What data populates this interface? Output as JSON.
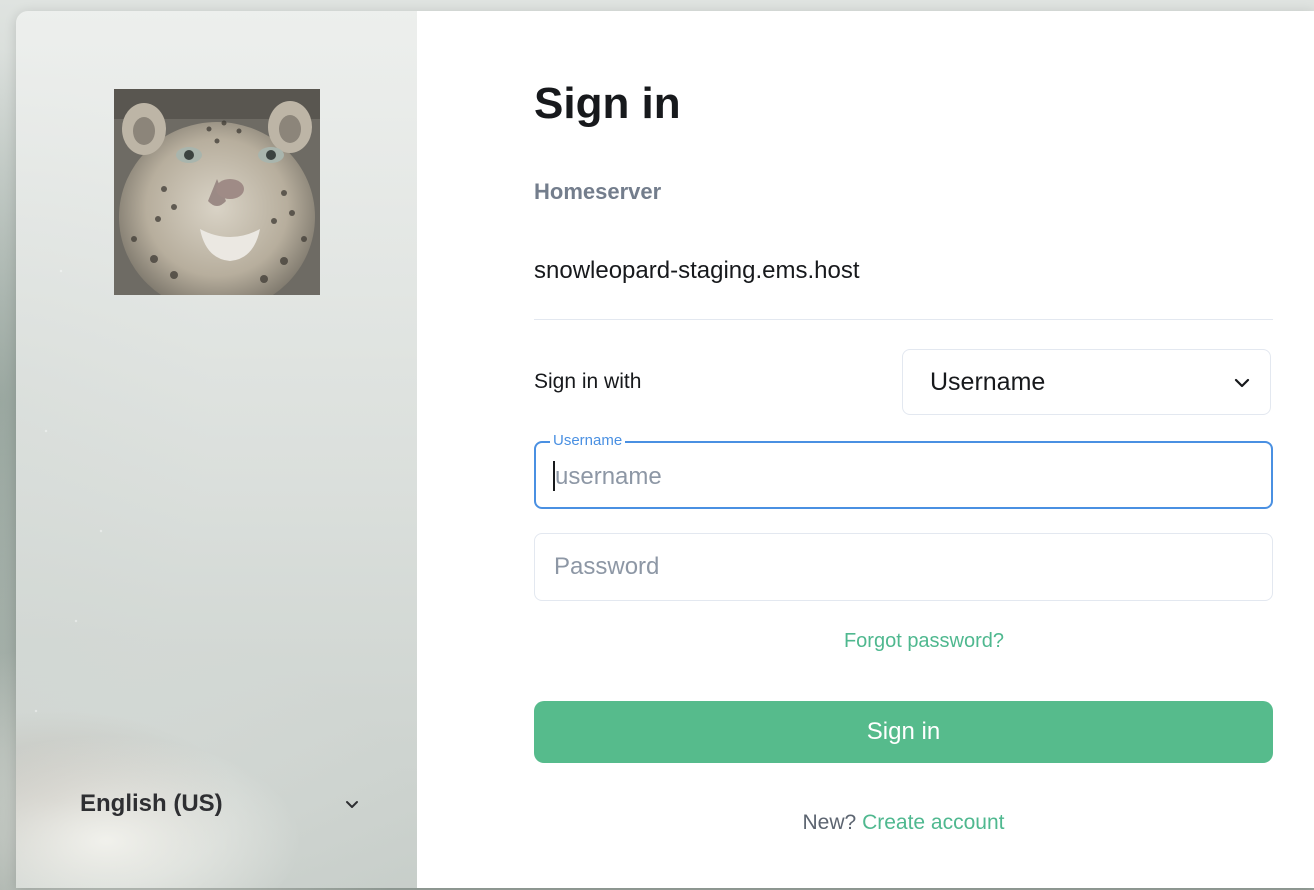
{
  "left_panel": {
    "avatar_icon": "snow-leopard-photo",
    "language": {
      "selected": "English (US)",
      "icon": "chevron-down-icon"
    }
  },
  "form": {
    "title": "Sign in",
    "homeserver": {
      "label": "Homeserver",
      "value": "snowleopard-staging.ems.host"
    },
    "sign_in_with": {
      "label": "Sign in with",
      "selected": "Username",
      "icon": "chevron-down-icon"
    },
    "username": {
      "label": "Username",
      "placeholder": "username",
      "value": ""
    },
    "password": {
      "placeholder": "Password",
      "value": ""
    },
    "forgot_password": "Forgot password?",
    "submit_label": "Sign in",
    "new_account": {
      "prefix": "New?",
      "link": "Create account"
    }
  },
  "colors": {
    "accent": "#56bb8c",
    "link": "#4fb88f",
    "focus": "#4a90e2",
    "muted": "#737d8c"
  }
}
